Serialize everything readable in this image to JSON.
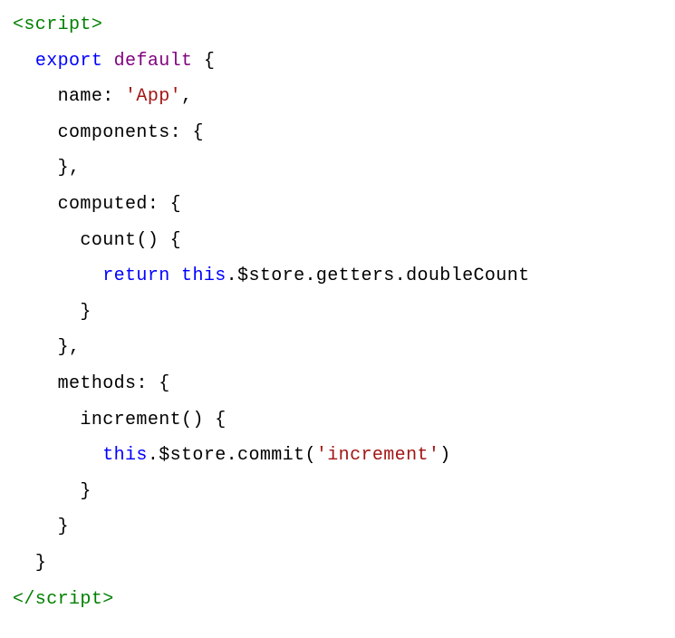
{
  "code": {
    "lines": [
      {
        "indent": 0,
        "tokens": [
          {
            "t": "<script>",
            "c": "tag"
          }
        ]
      },
      {
        "indent": 1,
        "tokens": [
          {
            "t": "export ",
            "c": "kw"
          },
          {
            "t": "default ",
            "c": "kw2"
          },
          {
            "t": "{",
            "c": "punct"
          }
        ]
      },
      {
        "indent": 2,
        "tokens": [
          {
            "t": "name",
            "c": "prop"
          },
          {
            "t": ": ",
            "c": "punct"
          },
          {
            "t": "'App'",
            "c": "str"
          },
          {
            "t": ",",
            "c": "punct"
          }
        ]
      },
      {
        "indent": 2,
        "tokens": [
          {
            "t": "components",
            "c": "prop"
          },
          {
            "t": ": {",
            "c": "punct"
          }
        ]
      },
      {
        "indent": 2,
        "tokens": [
          {
            "t": "},",
            "c": "punct"
          }
        ]
      },
      {
        "indent": 2,
        "tokens": [
          {
            "t": "computed",
            "c": "prop"
          },
          {
            "t": ": {",
            "c": "punct"
          }
        ]
      },
      {
        "indent": 3,
        "tokens": [
          {
            "t": "count",
            "c": "prop"
          },
          {
            "t": "() {",
            "c": "punct"
          }
        ]
      },
      {
        "indent": 4,
        "tokens": [
          {
            "t": "return ",
            "c": "kw"
          },
          {
            "t": "this",
            "c": "kw"
          },
          {
            "t": ".$store.getters.doubleCount",
            "c": "prop"
          }
        ]
      },
      {
        "indent": 3,
        "tokens": [
          {
            "t": "}",
            "c": "punct"
          }
        ]
      },
      {
        "indent": 2,
        "tokens": [
          {
            "t": "},",
            "c": "punct"
          }
        ]
      },
      {
        "indent": 2,
        "tokens": [
          {
            "t": "methods",
            "c": "prop"
          },
          {
            "t": ": {",
            "c": "punct"
          }
        ]
      },
      {
        "indent": 3,
        "tokens": [
          {
            "t": "increment",
            "c": "prop"
          },
          {
            "t": "() {",
            "c": "punct"
          }
        ]
      },
      {
        "indent": 4,
        "tokens": [
          {
            "t": "this",
            "c": "kw"
          },
          {
            "t": ".$store.commit(",
            "c": "prop"
          },
          {
            "t": "'increment'",
            "c": "str"
          },
          {
            "t": ")",
            "c": "prop"
          }
        ]
      },
      {
        "indent": 3,
        "tokens": [
          {
            "t": "}",
            "c": "punct"
          }
        ]
      },
      {
        "indent": 2,
        "tokens": [
          {
            "t": "}",
            "c": "punct"
          }
        ]
      },
      {
        "indent": 1,
        "tokens": [
          {
            "t": "}",
            "c": "punct"
          }
        ]
      },
      {
        "indent": 0,
        "tokens": [
          {
            "t": "</script>",
            "c": "tag"
          }
        ]
      }
    ],
    "indent_unit": "  "
  }
}
